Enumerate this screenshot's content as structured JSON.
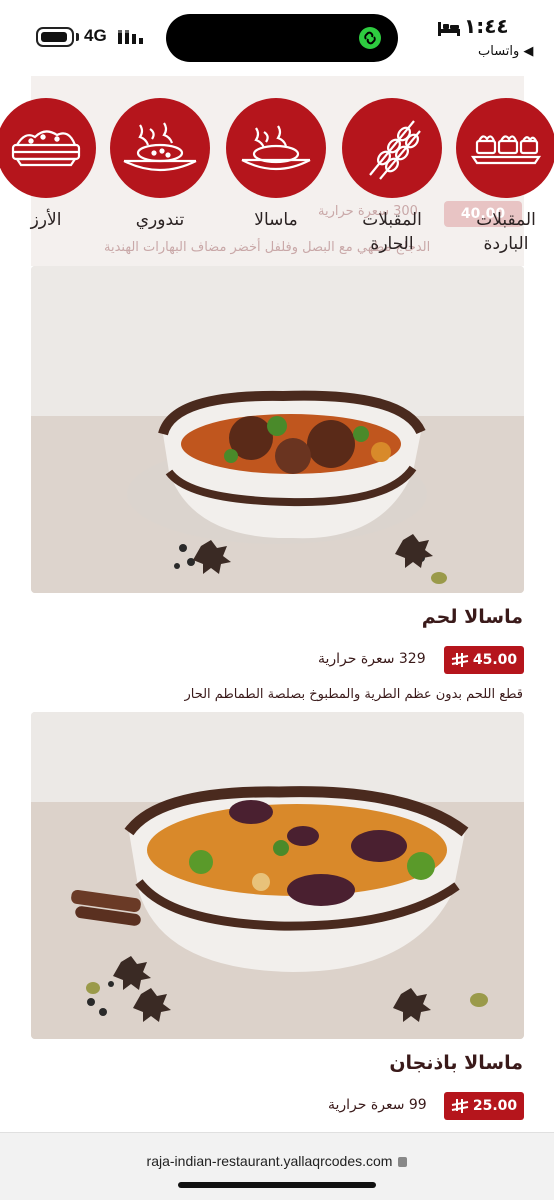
{
  "status_bar": {
    "network": "4G",
    "time": "١:٤٤",
    "back_app": "◀ واتساب"
  },
  "colors": {
    "brand": "#b5151c",
    "text": "#3a1a1a"
  },
  "behind": {
    "desc": "الدجاج مطهي مع البصل وفلفل أخضر مضاف البهارات الهندية",
    "cal": "300 سعرة حرارية",
    "price": "40.00"
  },
  "categories": [
    {
      "label": "المقبلات الباردة",
      "icon": "cold-appetizers-icon"
    },
    {
      "label": "المقبلات الحارة",
      "icon": "skewers-icon"
    },
    {
      "label": "ماسالا",
      "icon": "masala-dish-icon"
    },
    {
      "label": "تندوري",
      "icon": "tandoori-dish-icon"
    },
    {
      "label": "الأرز",
      "icon": "rice-bowl-icon"
    }
  ],
  "items": [
    {
      "title": "ماسالا لحم",
      "price": "45.00",
      "calories": "329 سعرة حرارية",
      "description": "قطع اللحم بدون عظم الطرية والمطبوخ بصلصة الطماطم الحار",
      "image": "meat-masala-photo"
    },
    {
      "title": "ماسالا باذنجان",
      "price": "25.00",
      "calories": "99 سعرة حرارية",
      "image": "eggplant-masala-photo"
    }
  ],
  "currency_icon": "riyal-symbol-icon",
  "url_bar": {
    "url": "raja-indian-restaurant.yallaqrcodes.com"
  }
}
